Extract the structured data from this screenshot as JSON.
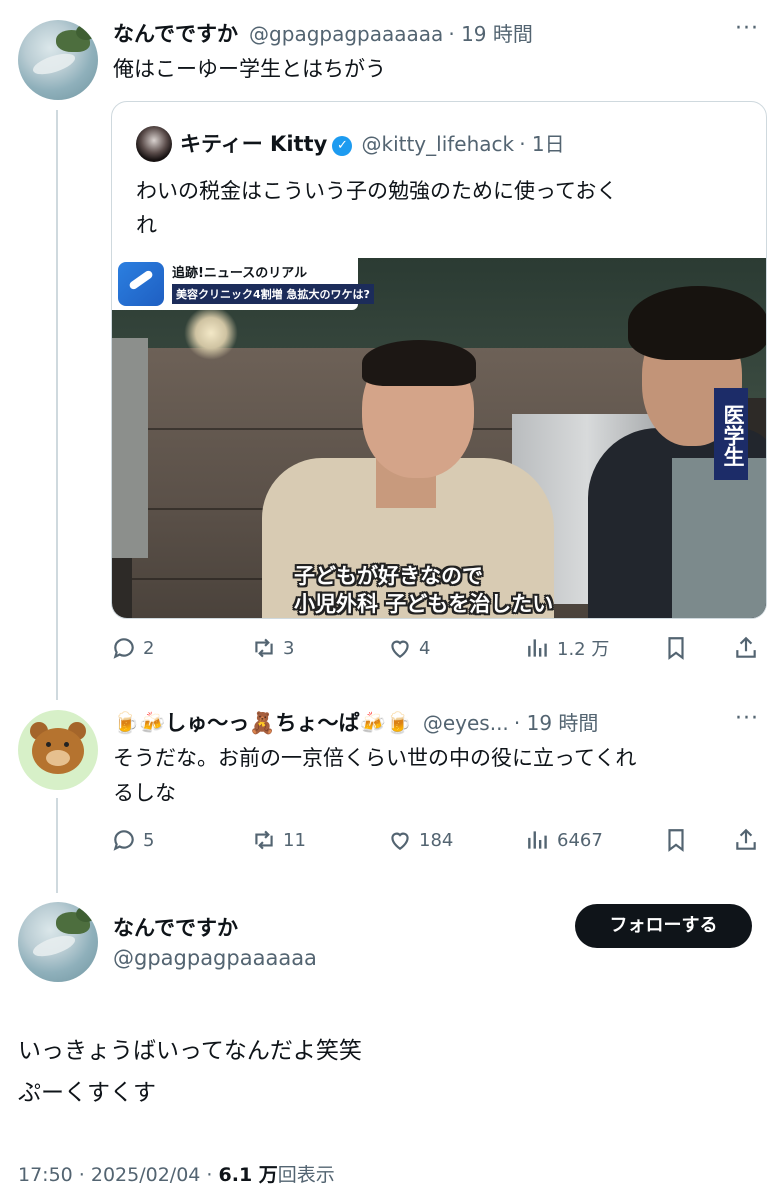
{
  "tweet1": {
    "display_name": "なんでですか",
    "handle": "@gpagpagpaaaaaa",
    "time": "· 19 時間",
    "text": "俺はこーゆー学生とはちがう",
    "more": "···"
  },
  "quote": {
    "display_name": "キティー Kitty",
    "verified_mark": "✓",
    "handle": "@kitty_lifehack",
    "time": "· 1日",
    "text_line1": "わいの税金はこういう子の勉強のために使っておく",
    "text_line2": "れ",
    "media": {
      "banner_line1": "追跡!ニュースのリアル",
      "banner_line2": "美容クリニック4割増 急拡大のワケは?",
      "tag": "医学生",
      "subtitle_line1": "子どもが好きなので",
      "subtitle_line2": "小児外科  子どもを治したい"
    }
  },
  "tweet1_actions": {
    "replies": "2",
    "reposts": "3",
    "likes": "4",
    "views": "1.2 万"
  },
  "tweet2": {
    "display_name": "🍺🍻しゅ〜っ🧸ちょ〜ぱ🍻🍺",
    "handle": "@eyes...",
    "time": "· 19 時間",
    "text_line1": "そうだな。お前の一京倍くらい世の中の役に立ってくれ",
    "text_line2": "るしな",
    "more": "···"
  },
  "tweet2_actions": {
    "replies": "5",
    "reposts": "11",
    "likes": "184",
    "views": "6467"
  },
  "main": {
    "display_name": "なんでですか",
    "handle": "@gpagpagpaaaaaa",
    "follow_label": "フォローする",
    "text_line1": "いっきょうばいってなんだよ笑笑",
    "text_line2": "ぷーくすくす",
    "time": "17:50 · 2025/02/04 · ",
    "views_count": "6.1 万",
    "views_label": "回表示"
  },
  "colors": {
    "text": "#0f1419",
    "secondary": "#536471",
    "border": "#cfd9de",
    "verified": "#1d9bf0",
    "follow_bg": "#0f1419"
  },
  "icons": [
    "reply-icon",
    "repost-icon",
    "like-icon",
    "views-icon",
    "bookmark-icon",
    "share-icon",
    "more-icon",
    "verified-icon"
  ]
}
